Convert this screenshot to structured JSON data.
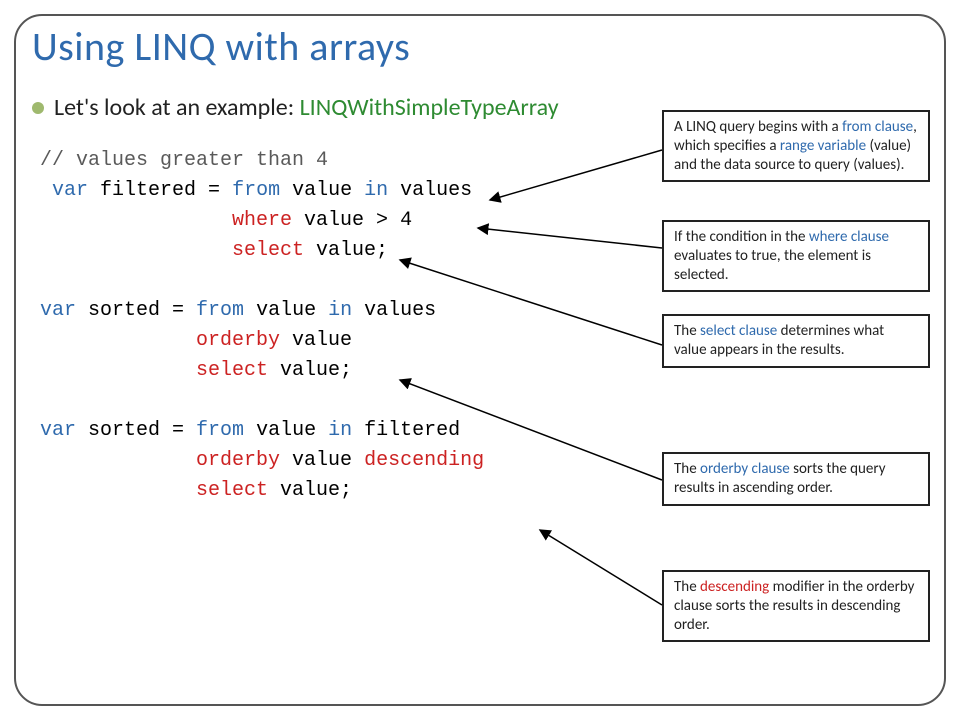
{
  "title": "Using LINQ with arrays",
  "bullet": {
    "lead": "Let's look at an example: ",
    "example": "LINQWithSimpleTypeArray"
  },
  "code": {
    "c1": "// values greater than 4",
    "c2a": "var",
    "c2b": " filtered = ",
    "c2c": "from",
    "c2d": " value ",
    "c2e": "in",
    "c2f": " values",
    "c3a": "where",
    "c3b": " value > 4",
    "c4a": "select",
    "c4b": " value;",
    "c5a": "var",
    "c5b": " sorted = ",
    "c5c": "from",
    "c5d": " value ",
    "c5e": "in",
    "c5f": " values",
    "c6a": "orderby",
    "c6b": " value",
    "c7a": "select",
    "c7b": " value;",
    "c8a": "var",
    "c8b": " sorted = ",
    "c8c": "from",
    "c8d": " value ",
    "c8e": "in",
    "c8f": " filtered",
    "c9a": "orderby",
    "c9b": " value ",
    "c9c": "descending",
    "c10a": "select",
    "c10b": " value;"
  },
  "callouts": {
    "from": {
      "pre": "A LINQ query begins with a ",
      "hl": "from clause",
      "post1": ", which specifies a ",
      "hl2": "range variable",
      "post2": " (value) and the data source to query (values)."
    },
    "where": {
      "pre": "If the condition in the ",
      "hl": "where clause",
      "post": " evaluates to true, the element is selected."
    },
    "select": {
      "pre": "The ",
      "hl": "select clause",
      "post": " determines what value appears in the results."
    },
    "orderby": {
      "pre": "The ",
      "hl": "orderby clause",
      "post": " sorts the query results in ascending order."
    },
    "descending": {
      "pre": "The ",
      "hl": "descending",
      "post": " modifier in the orderby clause sorts the results in descending order."
    }
  }
}
